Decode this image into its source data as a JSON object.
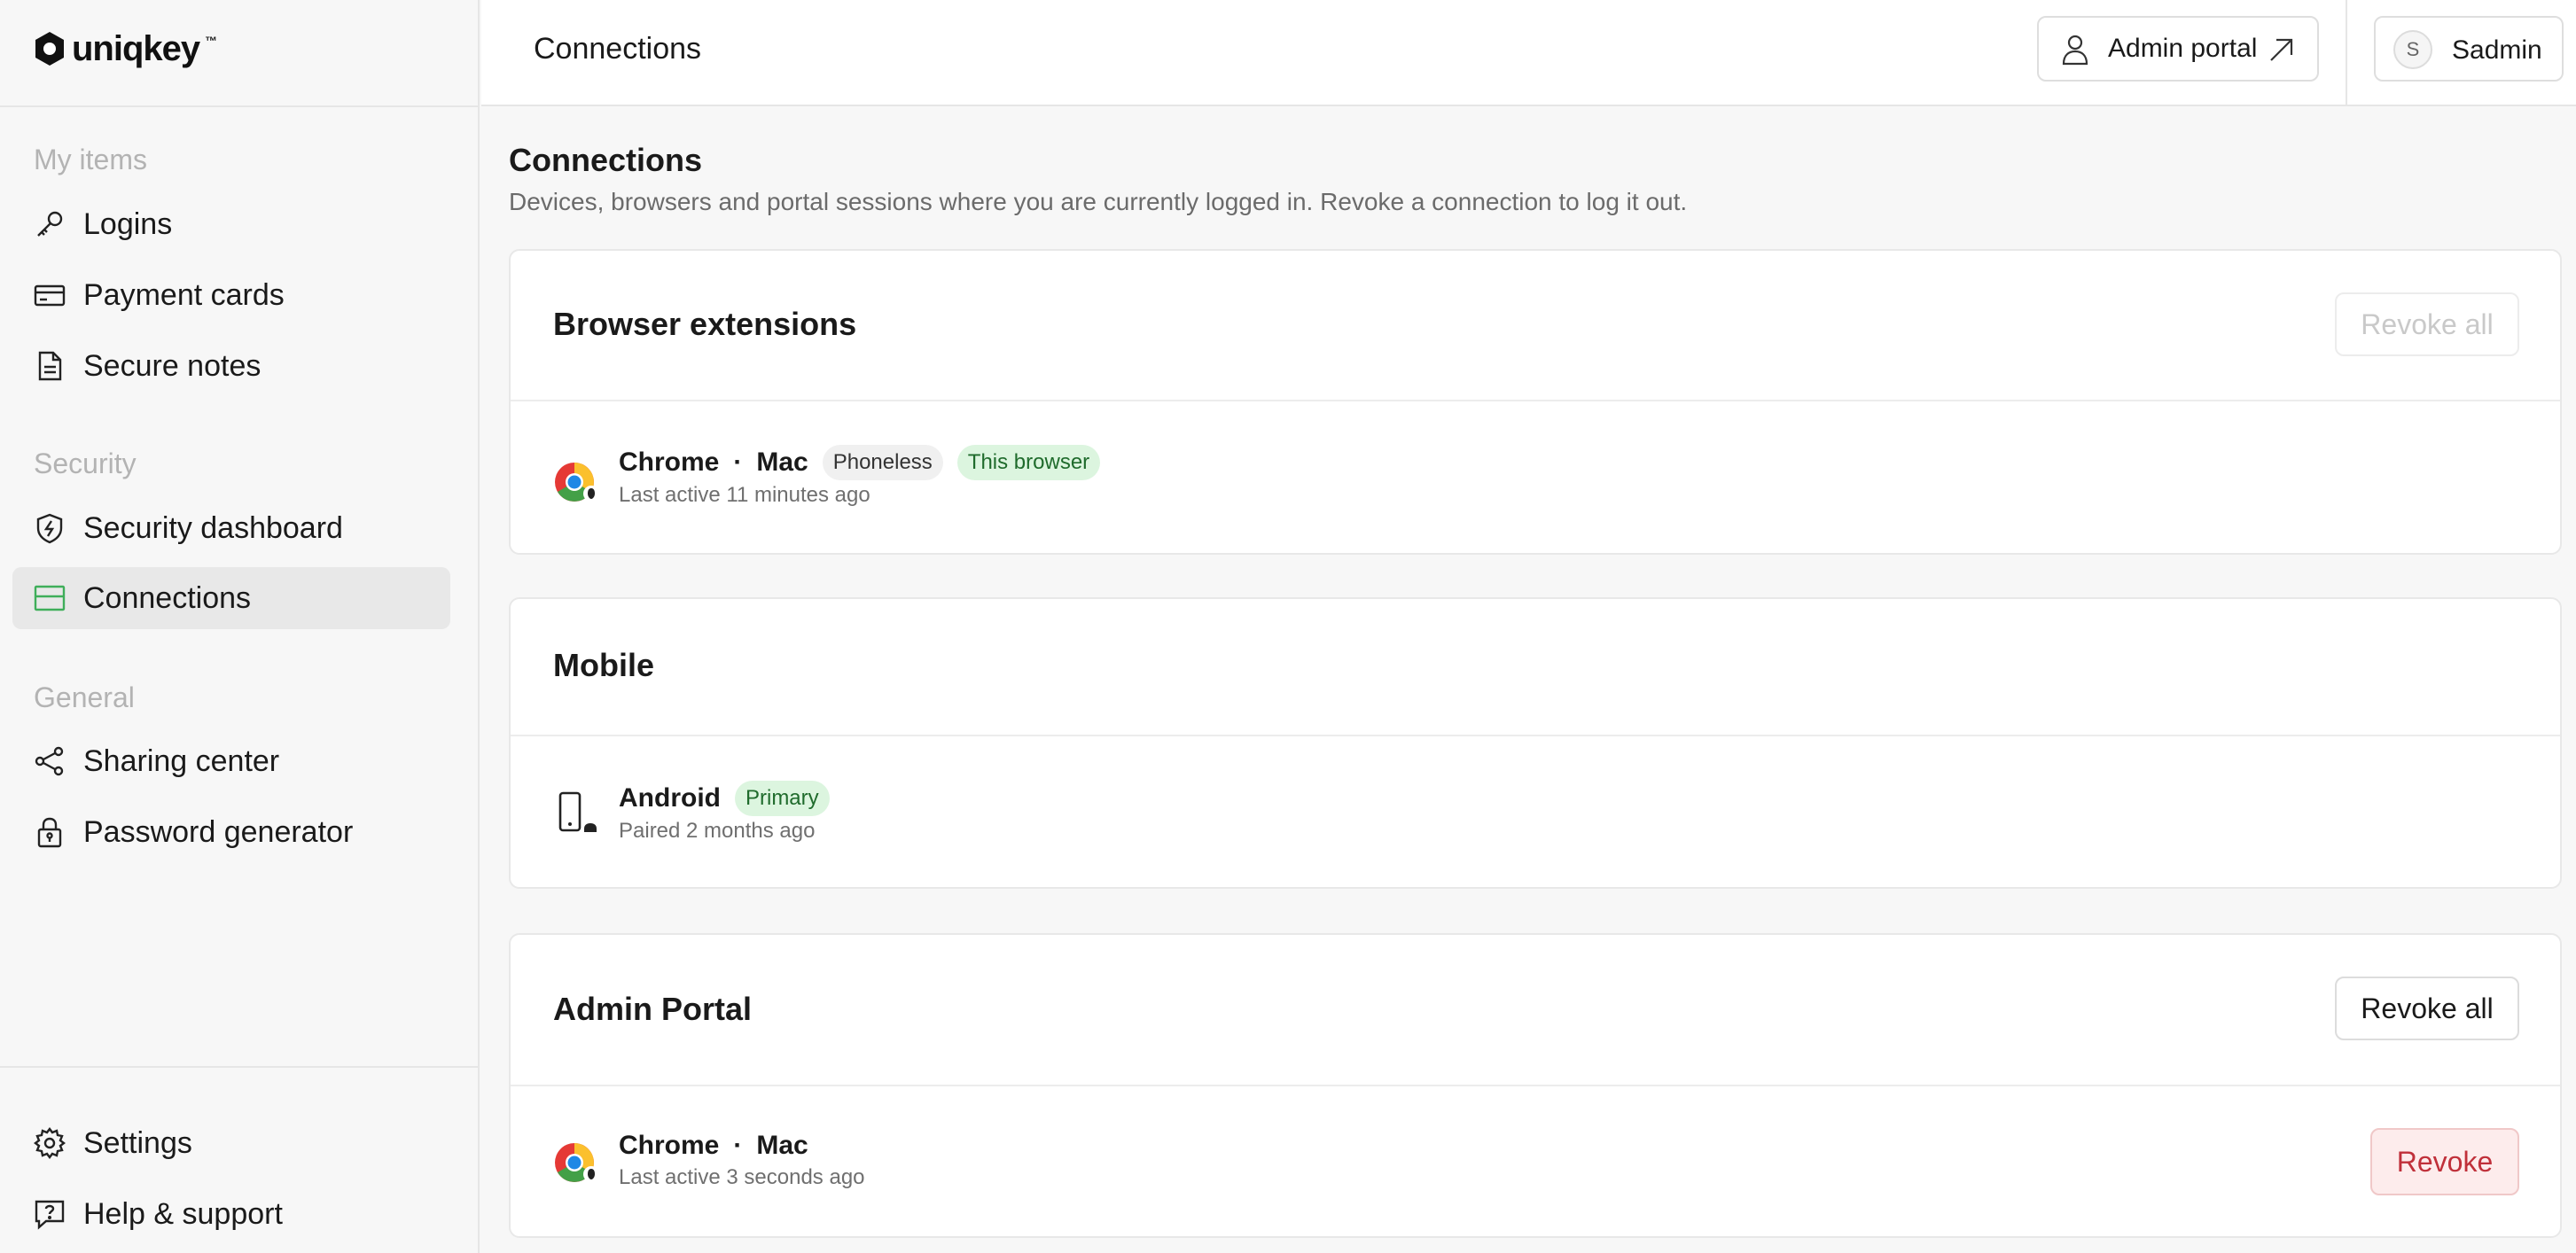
{
  "app": {
    "logo_text": "uniqkey",
    "logo_tm": "™"
  },
  "sidebar": {
    "sections": {
      "my_items": "My items",
      "security": "Security",
      "general": "General"
    },
    "items": [
      {
        "label": "Logins",
        "icon": "key-icon"
      },
      {
        "label": "Payment cards",
        "icon": "credit-card-icon"
      },
      {
        "label": "Secure notes",
        "icon": "document-icon"
      },
      {
        "label": "Security dashboard",
        "icon": "shield-icon"
      },
      {
        "label": "Connections",
        "icon": "connections-icon",
        "active": true
      },
      {
        "label": "Sharing center",
        "icon": "share-icon"
      },
      {
        "label": "Password generator",
        "icon": "lock-icon"
      }
    ],
    "footer": [
      {
        "label": "Settings",
        "icon": "gear-icon"
      },
      {
        "label": "Help & support",
        "icon": "help-icon"
      }
    ]
  },
  "topbar": {
    "title": "Connections",
    "admin_portal_label": "Admin portal",
    "user_initial": "S",
    "user_name": "Sadmin"
  },
  "main": {
    "heading": "Connections",
    "description": "Devices, browsers and portal sessions where you are currently logged in. Revoke a connection to log it out.",
    "cards": {
      "browser_extensions": {
        "title": "Browser extensions",
        "revoke_all_label": "Revoke all",
        "row": {
          "browser": "Chrome",
          "separator": "·",
          "os": "Mac",
          "badges": [
            "Phoneless",
            "This browser"
          ],
          "subtext": "Last active 11 minutes ago"
        }
      },
      "mobile": {
        "title": "Mobile",
        "row": {
          "device": "Android",
          "badge": "Primary",
          "subtext": "Paired 2 months ago"
        }
      },
      "admin_portal": {
        "title": "Admin Portal",
        "revoke_all_label": "Revoke all",
        "row": {
          "browser": "Chrome",
          "separator": "·",
          "os": "Mac",
          "subtext": "Last active 3 seconds ago",
          "revoke_label": "Revoke"
        }
      }
    }
  },
  "colors": {
    "accent_green": "#3fae5a",
    "badge_green_bg": "#dcf5df",
    "revoke_red": "#c0303a"
  }
}
